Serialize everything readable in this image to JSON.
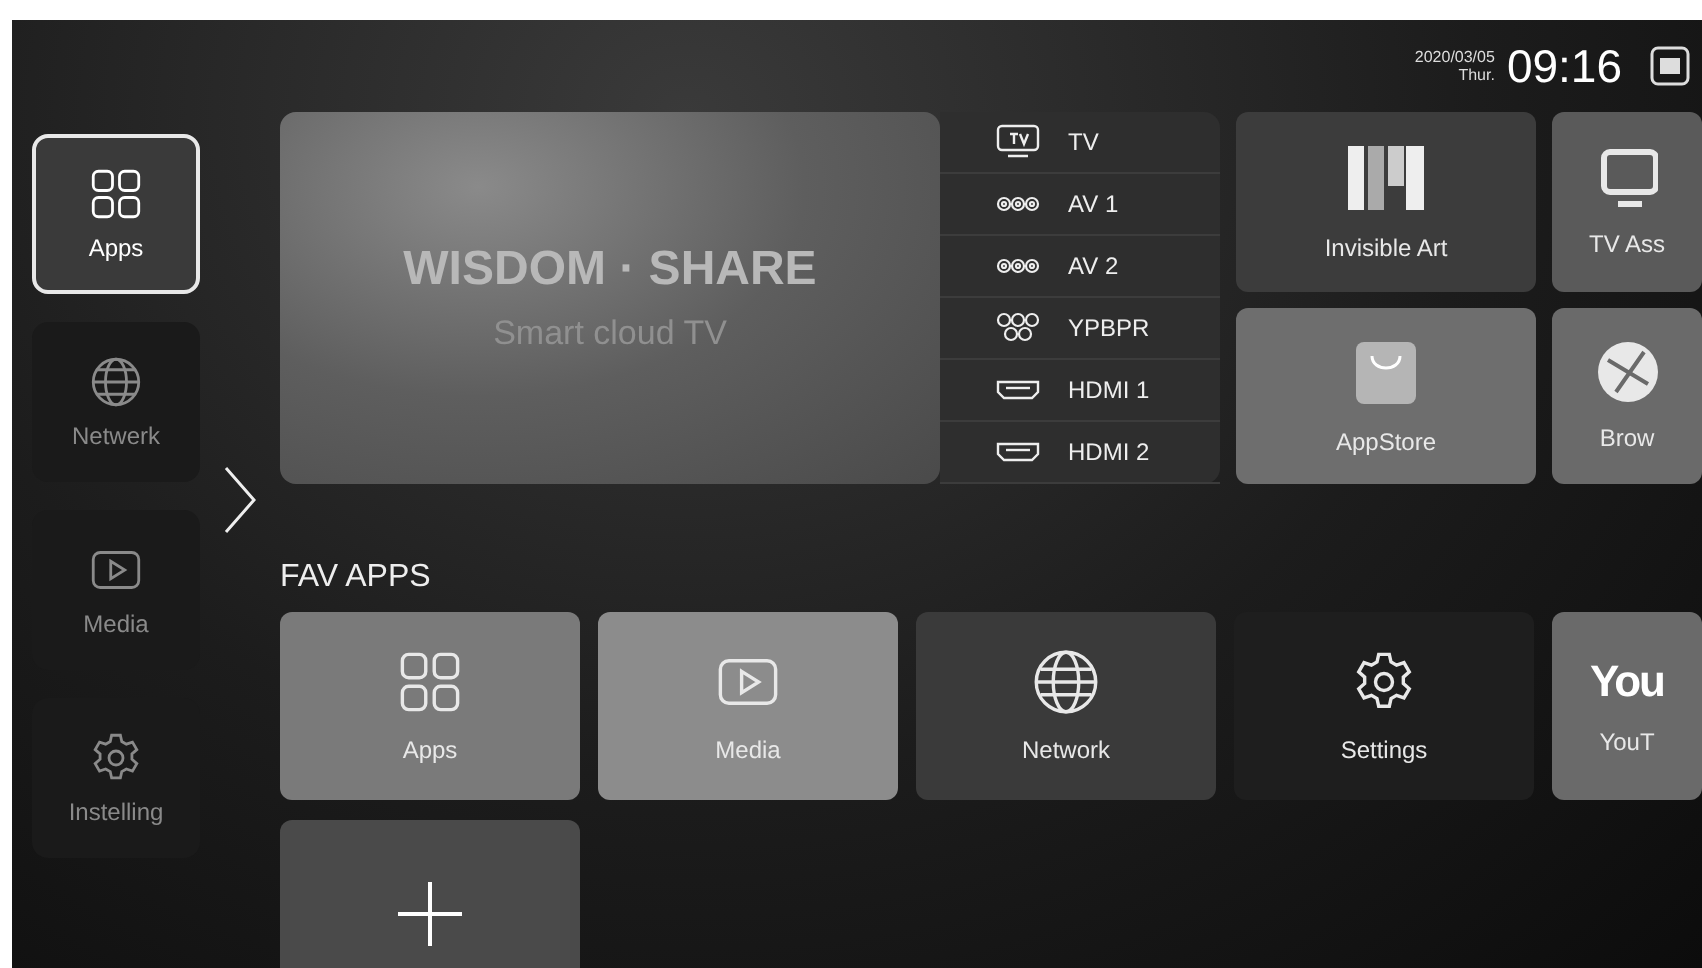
{
  "status_bar": {
    "date": "2020/03/05",
    "weekday": "Thur.",
    "time": "09:16"
  },
  "sidebar": {
    "items": [
      {
        "label": "Apps",
        "kind": "grid",
        "selected": true
      },
      {
        "label": "Netwerk",
        "kind": "globe",
        "selected": false
      },
      {
        "label": "Media",
        "kind": "media",
        "selected": false
      },
      {
        "label": "Instelling",
        "kind": "gear",
        "selected": false
      }
    ]
  },
  "banner": {
    "title": "WISDOM · SHARE",
    "subtitle": "Smart cloud TV"
  },
  "sources": [
    {
      "label": "TV",
      "kind": "tv"
    },
    {
      "label": "AV 1",
      "kind": "av"
    },
    {
      "label": "AV 2",
      "kind": "av"
    },
    {
      "label": "YPBPR",
      "kind": "ypbpr"
    },
    {
      "label": "HDMI 1",
      "kind": "hdmi"
    },
    {
      "label": "HDMI 2",
      "kind": "hdmi"
    }
  ],
  "featured_apps": [
    {
      "label": "Invisible Art",
      "kind": "art",
      "color": "#3c3c3c"
    },
    {
      "label": "TV Ass",
      "kind": "monitor",
      "color": "#5a5a5a"
    },
    {
      "label": "AppStore",
      "kind": "bag",
      "color": "#6e6e6e"
    },
    {
      "label": "Brow",
      "kind": "browser",
      "color": "#6a6a6a"
    }
  ],
  "fav_apps": {
    "title": "FAV APPS",
    "items": [
      {
        "label": "Apps",
        "kind": "grid",
        "color": "#7a7a7a"
      },
      {
        "label": "Media",
        "kind": "media",
        "color": "#8c8c8c"
      },
      {
        "label": "Network",
        "kind": "www",
        "color": "#3a3a3a"
      },
      {
        "label": "Settings",
        "kind": "gear",
        "color": "#1e1e1e"
      },
      {
        "label": "YouT",
        "kind": "youtube",
        "logo_text": "You",
        "color": "#6a6a6a"
      },
      {
        "kind": "add",
        "color": "#4a4a4a"
      }
    ]
  }
}
